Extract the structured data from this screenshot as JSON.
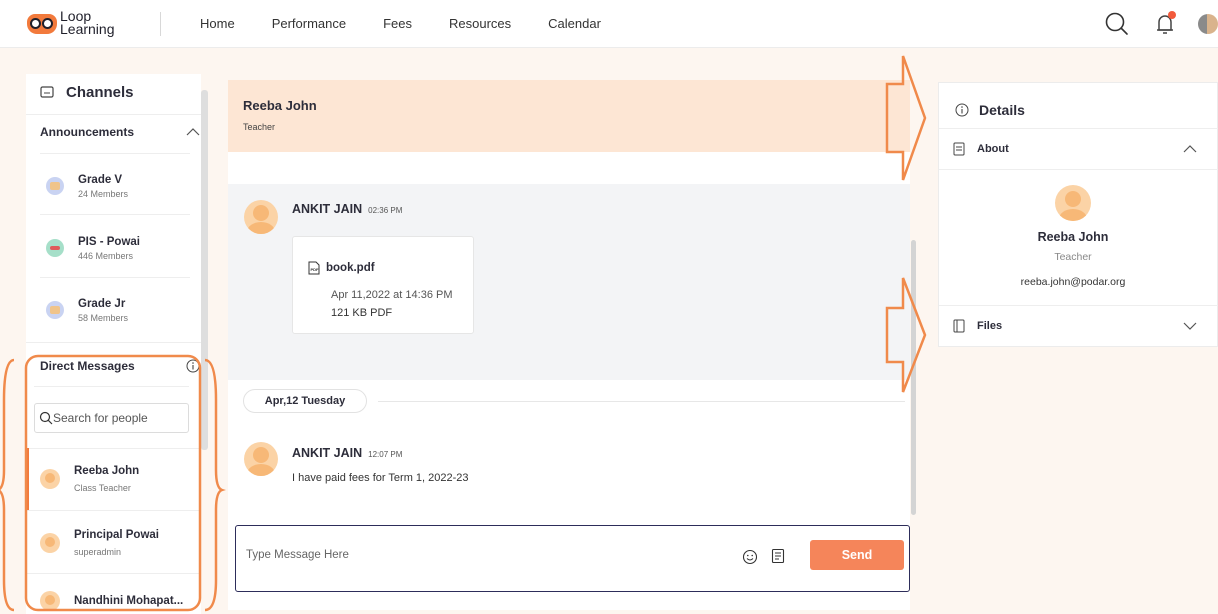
{
  "logo": {
    "line1": "Loop",
    "line2": "Learning"
  },
  "nav": {
    "items": [
      "Home",
      "Performance",
      "Fees",
      "Resources",
      "Calendar"
    ]
  },
  "sidebar": {
    "channels_title": "Channels",
    "announcements_label": "Announcements",
    "channels": [
      {
        "name": "Grade V",
        "members": "24 Members"
      },
      {
        "name": "PIS - Powai",
        "members": "446 Members"
      },
      {
        "name": "Grade Jr",
        "members": "58 Members"
      }
    ],
    "dm_label": "Direct Messages",
    "search_placeholder": "Search for people",
    "contacts": [
      {
        "name": "Reeba John",
        "role": "Class Teacher"
      },
      {
        "name": "Principal Powai",
        "role": "superadmin"
      },
      {
        "name": "Nandhini Mohapat...",
        "role": ""
      }
    ]
  },
  "chat": {
    "header_name": "Reeba John",
    "header_role": "Teacher",
    "messages": [
      {
        "author": "ANKIT JAIN",
        "time": "02:36 PM",
        "file_name": "book.pdf",
        "file_date": "Apr 11,2022 at 14:36 PM",
        "file_size": "121 KB PDF"
      },
      {
        "author": "ANKIT JAIN",
        "time": "12:07 PM",
        "text": "I have paid fees for Term 1, 2022-23"
      }
    ],
    "date_divider": "Apr,12 Tuesday",
    "composer_placeholder": "Type Message Here",
    "send_label": "Send"
  },
  "details": {
    "title": "Details",
    "about_label": "About",
    "name": "Reeba John",
    "role": "Teacher",
    "email": "reeba.john@podar.org",
    "files_label": "Files"
  },
  "colors": {
    "accent": "#f5855a",
    "header_bg": "#fde6d4",
    "page_bg": "#fdf6f0",
    "annotation": "#f08a4b"
  },
  "icons": [
    "search-icon",
    "bell-icon",
    "chat-icon",
    "chevron-up-icon",
    "chevron-down-icon",
    "info-icon",
    "pdf-icon",
    "emoji-icon",
    "attachment-icon",
    "document-icon",
    "files-icon"
  ]
}
